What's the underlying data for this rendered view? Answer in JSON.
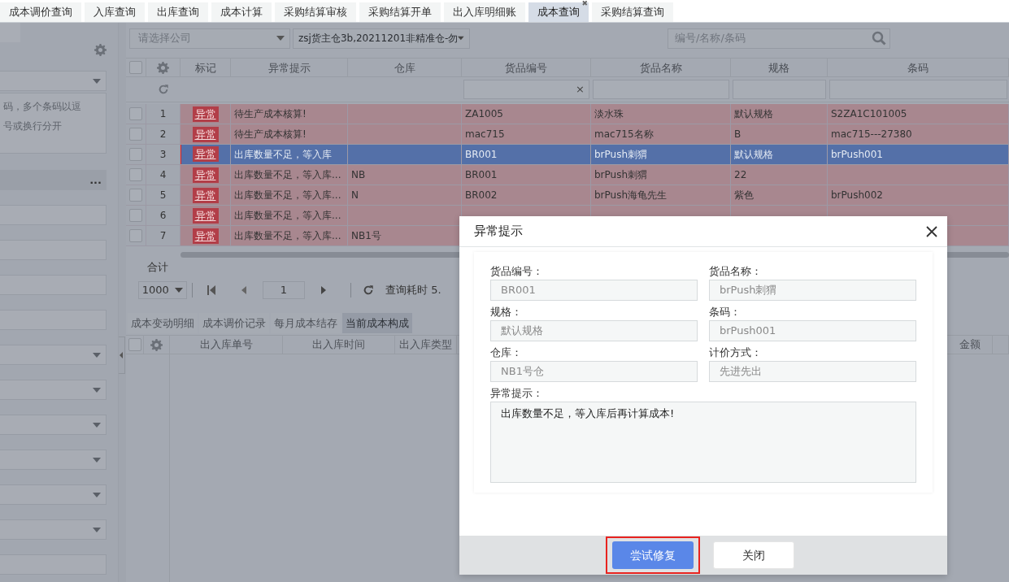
{
  "top_tabs": [
    {
      "label": "成本调价查询",
      "selected": false
    },
    {
      "label": "入库查询",
      "selected": false
    },
    {
      "label": "出库查询",
      "selected": false
    },
    {
      "label": "成本计算",
      "selected": false
    },
    {
      "label": "采购结算审核",
      "selected": false
    },
    {
      "label": "采购结算开单",
      "selected": false
    },
    {
      "label": "出入库明细账",
      "selected": false
    },
    {
      "label": "成本查询",
      "selected": true,
      "close_icon": "✖"
    },
    {
      "label": "采购结算查询",
      "selected": false
    }
  ],
  "sidebar": {
    "fields": [
      {
        "kind": "select"
      },
      {
        "kind": "textarea",
        "lines": [
          "码，多个条码以逗",
          "号或换行分开"
        ]
      },
      {
        "kind": "picker",
        "text": "..."
      },
      {
        "kind": "input"
      },
      {
        "kind": "input"
      },
      {
        "kind": "input"
      },
      {
        "kind": "input"
      },
      {
        "kind": "select"
      },
      {
        "kind": "select"
      },
      {
        "kind": "select"
      },
      {
        "kind": "select"
      },
      {
        "kind": "select"
      },
      {
        "kind": "select"
      },
      {
        "kind": "input"
      }
    ]
  },
  "toolbar": {
    "company_select": {
      "placeholder": "请选择公司"
    },
    "warehouse_select": {
      "value": "zsj货主仓3b,20211201非精准仓-勿"
    },
    "search": {
      "placeholder": "编号/名称/条码"
    }
  },
  "table": {
    "all_checked": false,
    "columns": [
      {
        "label": "标记",
        "kind": "tag",
        "filter": false
      },
      {
        "label": "异常提示",
        "kind": "text",
        "filter": false
      },
      {
        "label": "仓库",
        "kind": "text",
        "filter": false
      },
      {
        "label": "货品编号",
        "kind": "text",
        "filter": true,
        "clear": "×"
      },
      {
        "label": "货品名称",
        "kind": "text",
        "filter": true
      },
      {
        "label": "规格",
        "kind": "text",
        "filter": true
      },
      {
        "label": "条码",
        "kind": "text",
        "filter": true
      }
    ],
    "rows": [
      {
        "no": "1",
        "annotated": false,
        "checked": false,
        "selected": false,
        "cells": [
          "异常",
          "待生产成本核算!",
          null,
          "ZA1005",
          "淡水珠",
          "默认规格",
          "S2ZA1C101005"
        ]
      },
      {
        "no": "2",
        "annotated": false,
        "checked": false,
        "selected": false,
        "cells": [
          "异常",
          "待生产成本核算!",
          null,
          "mac715",
          "mac715名称",
          "B",
          "mac715---27380"
        ]
      },
      {
        "no": "3",
        "annotated": true,
        "checked": false,
        "selected": true,
        "cells": [
          "异常",
          "出库数量不足，等入库",
          null,
          "BR001",
          "brPush刺猬",
          "默认规格",
          "brPush001"
        ]
      },
      {
        "no": "4",
        "annotated": false,
        "checked": false,
        "selected": false,
        "cells": [
          "异常",
          "出库数量不足，等入库...",
          "NB",
          "BR001",
          "brPush刺猬",
          "22",
          null
        ]
      },
      {
        "no": "5",
        "annotated": false,
        "checked": false,
        "selected": false,
        "cells": [
          "异常",
          "出库数量不足，等入库...",
          "N",
          "BR002",
          "brPush海龟先生",
          "紫色",
          "brPush002"
        ]
      },
      {
        "no": "6",
        "annotated": false,
        "checked": false,
        "selected": false,
        "cells": [
          "异常",
          "出库数量不足，等入库...",
          null,
          null,
          null,
          null,
          null
        ]
      },
      {
        "no": "7",
        "annotated": false,
        "checked": false,
        "selected": false,
        "cells": [
          "异常",
          "出库数量不足，等入库...",
          "NB1号",
          null,
          null,
          null,
          null
        ]
      }
    ]
  },
  "summary_label": "合计",
  "pager": {
    "page_size": "1000",
    "page": "1",
    "elapsed": "查询耗时 5."
  },
  "bottom_tabs": [
    {
      "label": "成本变动明细",
      "selected": false
    },
    {
      "label": "成本调价记录",
      "selected": false
    },
    {
      "label": "每月成本结存",
      "selected": false
    },
    {
      "label": "当前成本构成",
      "selected": true
    }
  ],
  "bottom_table": {
    "all_checked": false,
    "columns": [
      "出入库单号",
      "出入库时间",
      "出入库类型",
      "金额"
    ]
  },
  "dialog": {
    "title": "异常提示",
    "fields": [
      {
        "label": "货品编号：",
        "value": "BR001",
        "disabled": true
      },
      {
        "label": "货品名称：",
        "value": "brPush刺猬",
        "disabled": true
      },
      {
        "label": "规格：",
        "value": "默认规格",
        "disabled": true
      },
      {
        "label": "条码：",
        "value": "brPush001",
        "disabled": true
      },
      {
        "label": "仓库：",
        "value": "NB1号仓",
        "disabled": true
      },
      {
        "label": "计价方式：",
        "value": "先进先出",
        "disabled": true
      }
    ],
    "hint_label": "异常提示：",
    "hint_text": "出库数量不足，等入库后再计算成本!",
    "buttons": [
      {
        "label": "尝试修复",
        "kind": "primary",
        "annotated": true
      },
      {
        "label": "关闭",
        "kind": "default",
        "annotated": false
      }
    ]
  }
}
